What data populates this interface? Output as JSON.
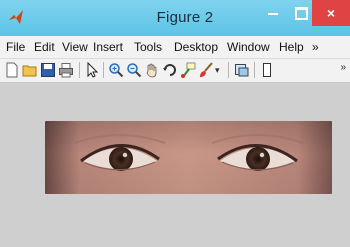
{
  "window": {
    "title": "Figure 2",
    "close_glyph": "×"
  },
  "menu": {
    "items": [
      "File",
      "Edit",
      "View",
      "Insert",
      "Tools",
      "Desktop",
      "Window",
      "Help"
    ],
    "overflow": "»"
  },
  "toolbar": {
    "icons": [
      "new-figure-icon",
      "open-file-icon",
      "save-icon",
      "print-icon",
      "select-arrow-icon",
      "zoom-in-icon",
      "zoom-out-icon",
      "pan-hand-icon",
      "rotate-3d-icon",
      "data-cursor-icon",
      "brush-icon",
      "link-plot-icon",
      "colorbar-icon"
    ],
    "overflow": "»"
  },
  "colors": {
    "titlebar": "#6ccbeb",
    "close_button": "#e04343",
    "figure_bg": "#cfcfcf"
  }
}
